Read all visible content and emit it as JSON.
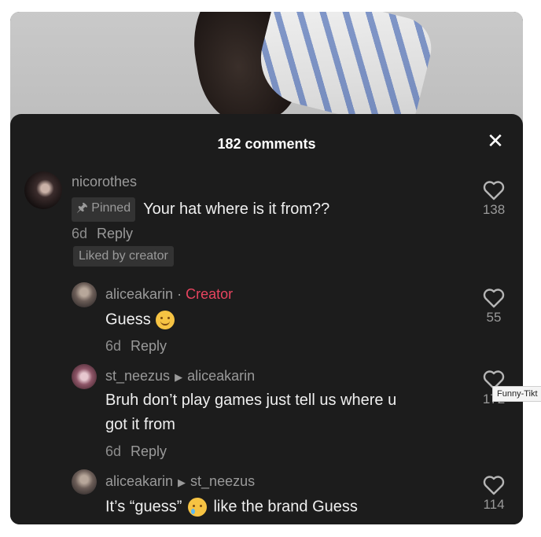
{
  "header": {
    "title": "182 comments",
    "close_glyph": "✕"
  },
  "watermark": "Funny-Tikt",
  "comments": [
    {
      "username": "nicorothes",
      "pinned_label": "Pinned",
      "text": "Your hat where is it from??",
      "age": "6d",
      "reply_label": "Reply",
      "liked_by": "Liked by creator",
      "likes": "138"
    },
    {
      "username": "aliceakarin",
      "separator": "·",
      "badge": "Creator",
      "text": "Guess",
      "emoji": "smiling-face",
      "age": "6d",
      "reply_label": "Reply",
      "likes": "55"
    },
    {
      "username": "st_neezus",
      "reply_to": "aliceakarin",
      "text_line1": "Bruh don’t play games just tell us where u",
      "text_line2": "got it from",
      "age": "6d",
      "reply_label": "Reply",
      "likes": "172"
    },
    {
      "username": "aliceakarin",
      "reply_to": "st_neezus",
      "text_before": "It’s “guess”",
      "emoji": "crying-face",
      "text_after": "like the brand Guess",
      "likes": "114"
    }
  ],
  "icons": {
    "heart": "heart-icon",
    "pin": "pin-icon",
    "close": "close-icon"
  },
  "colors": {
    "sheet": "#1c1c1c",
    "creator": "#e8445f",
    "muted": "#9a9a9a"
  }
}
